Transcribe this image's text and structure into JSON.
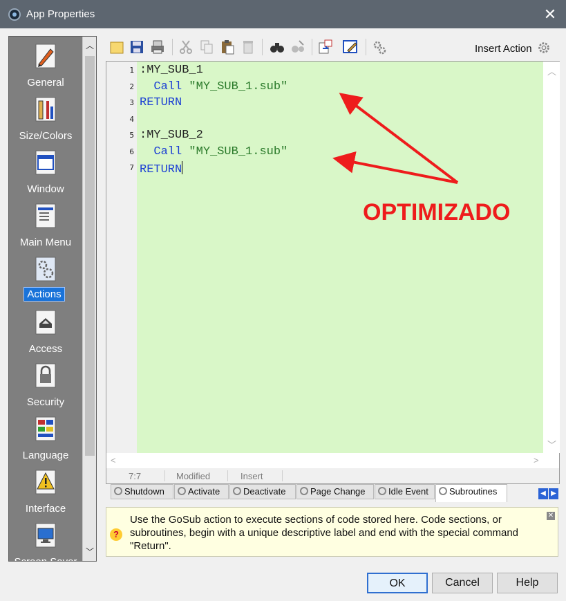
{
  "window": {
    "title": "App Properties",
    "close_glyph": "✕"
  },
  "sidebar": {
    "items": [
      {
        "label": "General",
        "icon": "general-icon"
      },
      {
        "label": "Size/Colors",
        "icon": "size-colors-icon"
      },
      {
        "label": "Window",
        "icon": "window-icon"
      },
      {
        "label": "Main Menu",
        "icon": "main-menu-icon"
      },
      {
        "label": "Actions",
        "icon": "actions-icon",
        "selected": true
      },
      {
        "label": "Access",
        "icon": "access-icon"
      },
      {
        "label": "Security",
        "icon": "security-icon"
      },
      {
        "label": "Language",
        "icon": "language-icon"
      },
      {
        "label": "Interface",
        "icon": "interface-icon"
      },
      {
        "label": "Screen Saver",
        "icon": "screen-saver-icon"
      }
    ],
    "scroll_up": "︿",
    "scroll_down": "﹀"
  },
  "toolbar": {
    "insert_action_label": "Insert Action"
  },
  "editor": {
    "line_numbers": [
      "1",
      "2",
      "3",
      "4",
      "5",
      "6",
      "7"
    ],
    "lines": [
      {
        "parts": [
          {
            "t": ":MY_SUB_1",
            "c": "plain"
          }
        ]
      },
      {
        "parts": [
          {
            "t": "  Call ",
            "c": "kw"
          },
          {
            "t": "\"MY_SUB_1.sub\"",
            "c": "str"
          }
        ]
      },
      {
        "parts": [
          {
            "t": "RETURN",
            "c": "kw"
          }
        ]
      },
      {
        "parts": [
          {
            "t": "",
            "c": "plain"
          }
        ]
      },
      {
        "parts": [
          {
            "t": ":MY_SUB_2",
            "c": "plain"
          }
        ]
      },
      {
        "parts": [
          {
            "t": "  Call ",
            "c": "kw"
          },
          {
            "t": "\"MY_SUB_1.sub\"",
            "c": "str"
          }
        ]
      },
      {
        "parts": [
          {
            "t": "RETURN",
            "c": "kw"
          }
        ]
      }
    ],
    "colors": {
      "code_bg": "#d9f7c8",
      "keyword": "#1b3fd4",
      "string": "#2a7a2a"
    }
  },
  "status": {
    "position": "7:7",
    "modified": "Modified",
    "mode": "Insert"
  },
  "tabs": [
    {
      "label": "Shutdown"
    },
    {
      "label": "Activate"
    },
    {
      "label": "Deactivate"
    },
    {
      "label": "Page Change"
    },
    {
      "label": "Idle Event"
    },
    {
      "label": "Subroutines",
      "active": true
    }
  ],
  "help": {
    "text": "Use the GoSub action to execute sections of code stored here. Code sections, or subroutines, begin with a unique descriptive label and end with the special command \"Return\".",
    "icon": "question-icon",
    "close_glyph": "✕"
  },
  "buttons": {
    "ok": "OK",
    "cancel": "Cancel",
    "help": "Help"
  },
  "annotation": {
    "label": "OPTIMIZADO",
    "color": "#ee1c1c"
  }
}
